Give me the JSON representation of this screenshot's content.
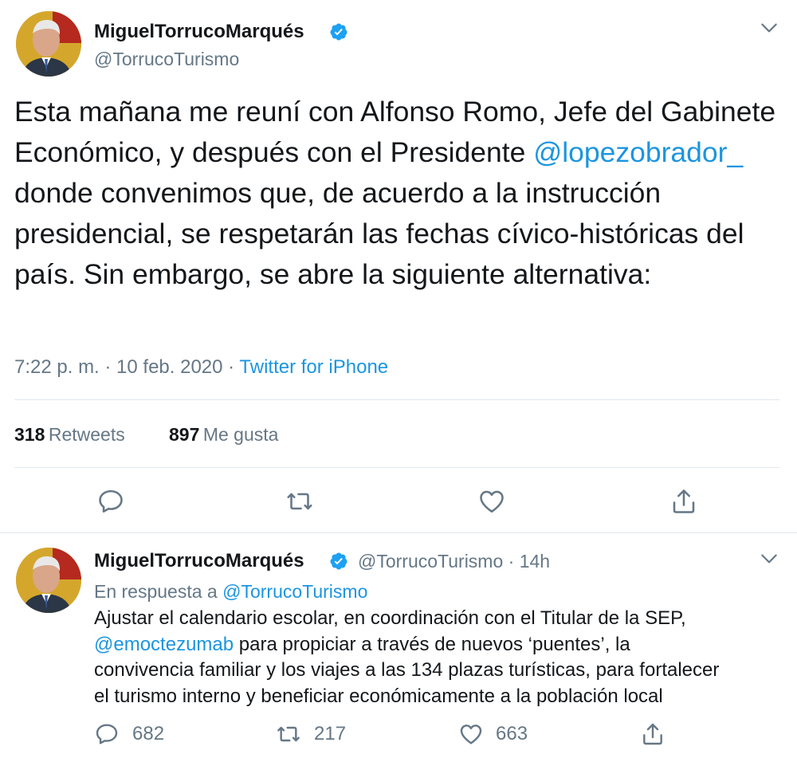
{
  "main_tweet": {
    "author_name": "MiguelTorrucoMarqués",
    "author_handle": "@TorrucoTurismo",
    "text_before_mention": "Esta mañana me reuní con Alfonso Romo, Jefe del Gabinete Económico,   y después con el Presidente ",
    "mention": "@lopezobrador_",
    "text_after_mention": " donde convenimos que, de acuerdo a la instrucción presidencial, se respetarán las fechas cívico-históricas del país. Sin embargo, se abre la siguiente alternativa:",
    "timestamp": "7:22 p. m. · 10 feb. 2020 · ",
    "source": "Twitter for iPhone",
    "retweets_count": "318",
    "retweets_label": "Retweets",
    "likes_count": "897",
    "likes_label": "Me gusta"
  },
  "reply_tweet": {
    "author_name": "MiguelTorrucoMarqués",
    "author_handle": "@TorrucoTurismo",
    "time_ago": "· 14h",
    "replying_prefix": "En respuesta a ",
    "replying_to": "@TorrucoTurismo",
    "text_line1": "Ajustar el calendario escolar, en coordinación con el Titular de la SEP,",
    "mention": "@emoctezumab",
    "text_line2_rest": " para propiciar a través de nuevos ‘puentes’, la",
    "text_line3": "convivencia familiar y los viajes a las 134 plazas turísticas, para fortalecer",
    "text_line4": "el turismo interno y beneficiar económicamente a la población local",
    "reply_count": "682",
    "retweet_count": "217",
    "like_count": "663"
  },
  "icons": {
    "verified": "verified-badge-icon",
    "menu": "chevron-down-icon",
    "reply": "speech-bubble-icon",
    "retweet": "retweet-arrows-icon",
    "like": "heart-icon",
    "share": "share-upload-icon"
  },
  "colors": {
    "link": "#1b95e0",
    "secondary_text": "#657786",
    "primary_text": "#14171a",
    "divider": "#e1e8ed",
    "verified": "#1da1f2"
  }
}
